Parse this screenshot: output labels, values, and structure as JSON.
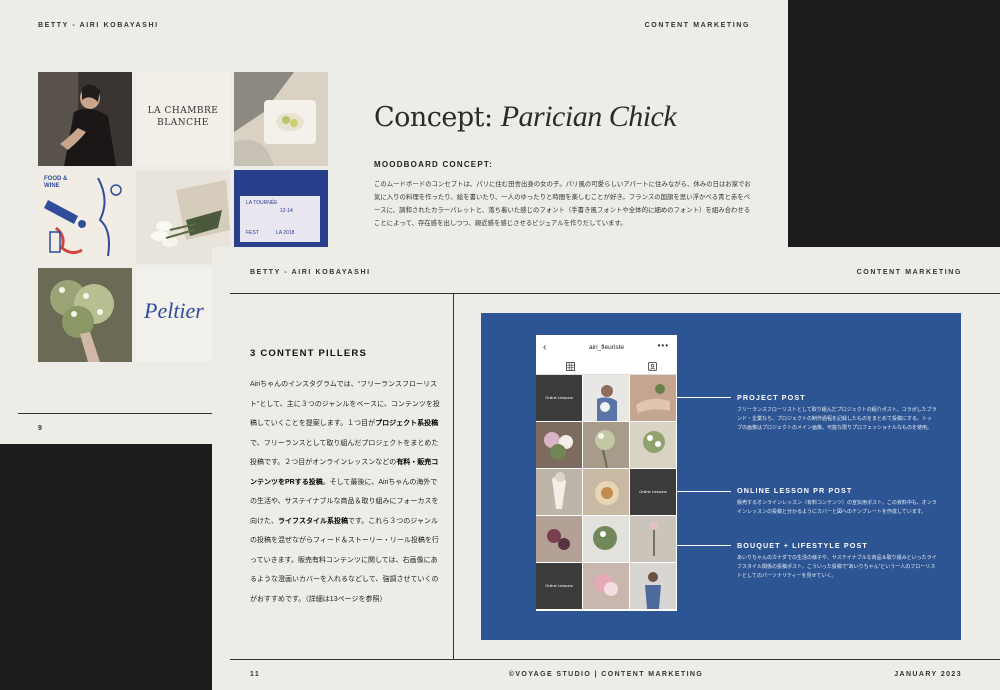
{
  "page1": {
    "header_left": "BETTY - AIRI KOBAYASHI",
    "header_right": "CONTENT MARKETING",
    "title_plain": "Concept: ",
    "title_italic": "Parician Chick",
    "subtitle": "MOODBOARD CONCEPT:",
    "body": "このムードボードのコンセプトは、パリに住む田舎出身の女の子。パリ風の可愛らしいアパートに住みながら、休みの日はお家でお気に入りの料理を作ったり、絵を書いたり、一人のゆったりと時間を楽しむことが好き。フランスの国旗を思い浮かべる青と赤をベースに、調和されたカラーパレットと、落ち着いた感じのフォント（手書き風フォントや全体的に細めのフォント）を組み合わせることによって、存在感を出しつつ、親近感を感じさせるビジュアルを作りだしています。",
    "page_number": "9",
    "tiles": {
      "chambre_line1": "LA CHAMBRE",
      "chambre_line2": "BLANCHE",
      "ticket_text": "LA TOURNÉE",
      "ticket_date": "12-14",
      "ticket_fest": "FEST",
      "ticket_year": "LA 2018",
      "food_text": "FOOD & WINE",
      "peltier_text": "Peltier"
    }
  },
  "page2": {
    "header_left": "BETTY - AIRI KOBAYASHI",
    "header_right": "CONTENT MARKETING",
    "section_title": "3 CONTENT PILLERS",
    "body_parts": [
      {
        "t": "Airiちゃんのインスタグラムでは、“フリーランスフローリスト”として、主に３つのジャンルをベースに、コンテンツを投稿していくことを提案します。１つ目が",
        "b": false
      },
      {
        "t": "プロジェクト系投稿",
        "b": true
      },
      {
        "t": "で、フリーランスとして取り組んだプロジェクトをまとめた投稿です。２つ目がオンラインレッスンなどの",
        "b": false
      },
      {
        "t": "有料・販売コンテンツをPRする投稿",
        "b": true
      },
      {
        "t": "。そして最後に、Airiちゃんの海外での生活や、サステイナブルな商品＆取り組みにフォーカスを向けた、",
        "b": false
      },
      {
        "t": "ライフスタイル系投稿",
        "b": true
      },
      {
        "t": "です。これら３つのジャンルの投稿を混ぜながらフィード＆ストーリー・リール投稿を行っていきます。販売有料コンテンツに関しては、右画像にあるような澄画いカバーを入れるなどして、強調させていくのがおすすめです。（詳細は13ページを参照）",
        "b": false
      }
    ],
    "footer_left": "11",
    "footer_center": "©VOYAGE STUDIO | CONTENT MARKETING",
    "footer_right": "JANUARY 2023",
    "phone": {
      "username": "airi_fleuriste",
      "back_glyph": "‹",
      "more_glyph": "•••",
      "cover_label": "Online Lessons"
    },
    "callouts": [
      {
        "title": "PROJECT POST",
        "body": "フリーランスフローリストとして取り組んだプロジェクトの紹介ポスト。コラボしたブランド・企業なら、プロジェクトの制作過程を記録したものをまとめて投稿にする。トップの画像はプロジェクトのメイン画像。可能な限りプロフェッショナルなものを使用。"
      },
      {
        "title": "ONLINE LESSON PR POST",
        "body": "販売するオンラインレッスン（有料コンテンツ）の宣伝用ポスト。この資料中も、オンラインレッスンの投稿と分かるようにカバーと図へのテンプレートを作成しています。"
      },
      {
        "title": "BOUQUET + LIFESTYLE POST",
        "body": "あいりちゃんのカナダでの生活の様子や、サステイナブルな商品＆取り組みといったライフスタイル関係の投稿ポスト。こういった投稿で“あいりちゃん”という一人のフローリストとしてのパーソナリティーを見せていく。"
      }
    ]
  },
  "colors": {
    "paper": "#eeece7",
    "panel_blue": "#2e5593",
    "background": "#1c1c1c"
  }
}
